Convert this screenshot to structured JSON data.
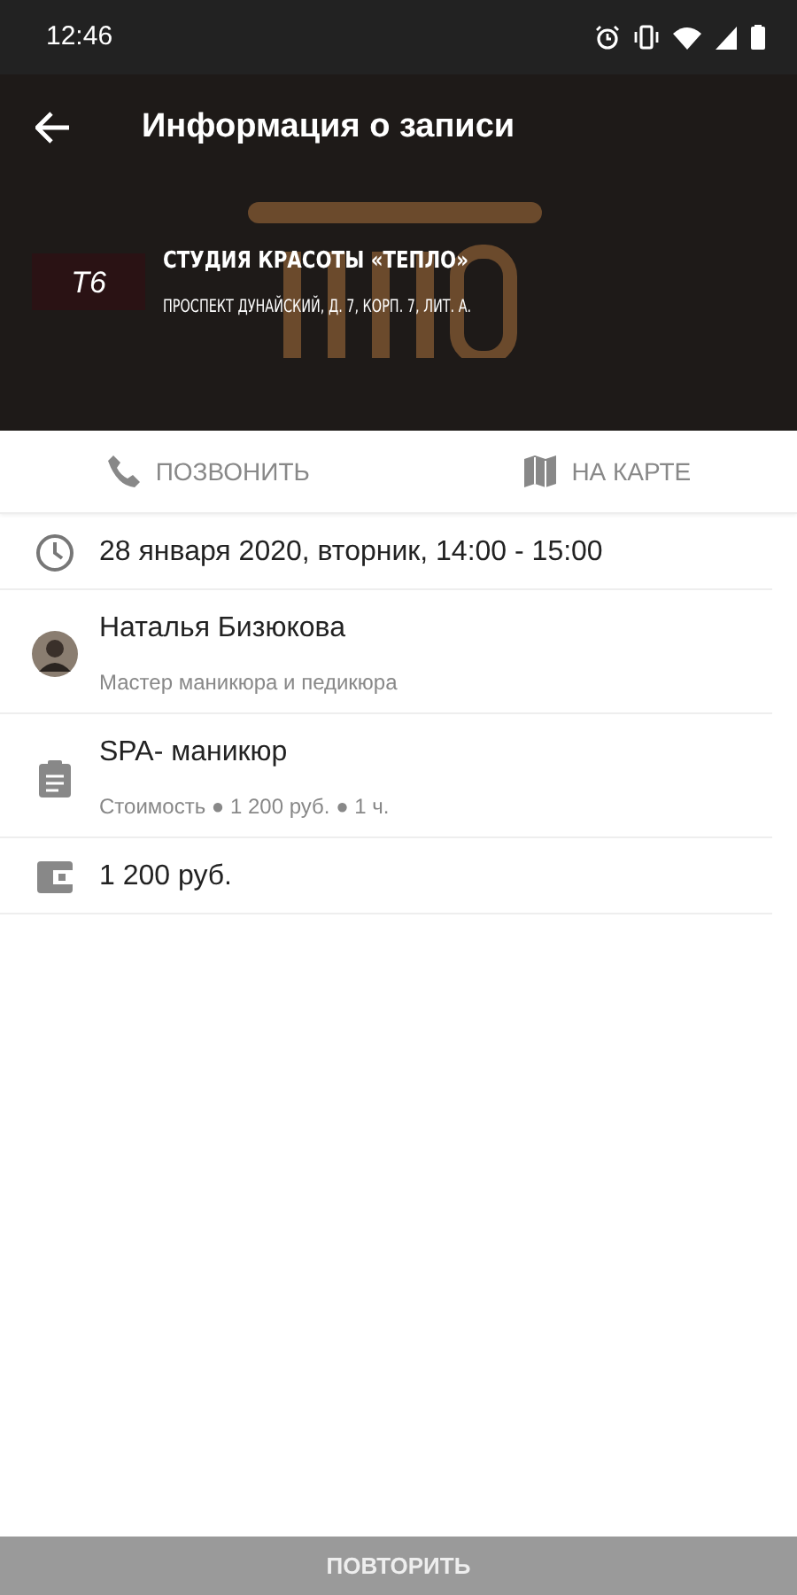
{
  "status_bar": {
    "time": "12:46"
  },
  "toolbar": {
    "title": "Информация о записи"
  },
  "salon": {
    "logo_text": "Т6",
    "name": "СТУДИЯ КРАСОТЫ «ТЕПЛО»",
    "address": "ПРОСПЕКТ ДУНАЙСКИЙ, Д. 7, КОРП. 7, ЛИТ. А."
  },
  "actions": [
    {
      "kind": "phone",
      "label": "ПОЗВОНИТЬ"
    },
    {
      "kind": "map",
      "label": "НА КАРТЕ"
    }
  ],
  "details": [
    {
      "kind": "clock",
      "title": "28 января 2020, вторник, 14:00 - 15:00"
    },
    {
      "kind": "avatar",
      "title": "Наталья Бизюкова",
      "subtitle": "Мастер маникюра и педикюра"
    },
    {
      "kind": "clipboard",
      "title": "SPA- маникюр",
      "subtitle": "Стоимость ● 1 200 руб. ● 1 ч."
    },
    {
      "kind": "wallet",
      "title": "1 200 руб."
    }
  ],
  "bottom_button": {
    "label": "ПОВТОРИТЬ"
  }
}
